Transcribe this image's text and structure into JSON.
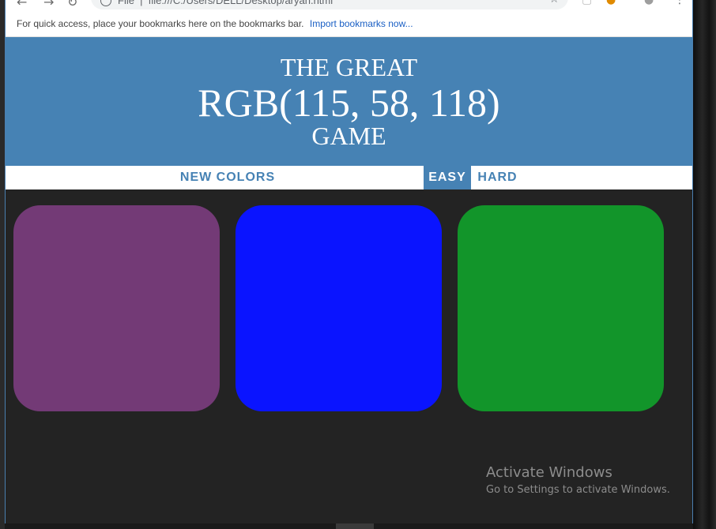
{
  "browser": {
    "url_scheme": "File",
    "url": "file:///C:/Users/DELL/Desktop/aryan.html",
    "bookmarks_bar_text": "For quick access, place your bookmarks here on the bookmarks bar.",
    "bookmarks_import_link": "Import bookmarks now..."
  },
  "header": {
    "line1": "THE GREAT",
    "color_display": "RGB(115, 58, 118)",
    "line3": "GAME"
  },
  "stripe": {
    "reset_label": "NEW COLORS",
    "easy_label": "EASY",
    "hard_label": "HARD",
    "selected_mode": "EASY"
  },
  "squares": [
    {
      "color": "#733a76"
    },
    {
      "color": "#0a14ff"
    },
    {
      "color": "#12952a"
    }
  ],
  "watermark": {
    "title": "Activate Windows",
    "subtitle": "Go to Settings to activate Windows."
  },
  "colors": {
    "header_bg": "#4682b4",
    "page_bg": "#232323",
    "stripe_bg": "#ffffff"
  }
}
